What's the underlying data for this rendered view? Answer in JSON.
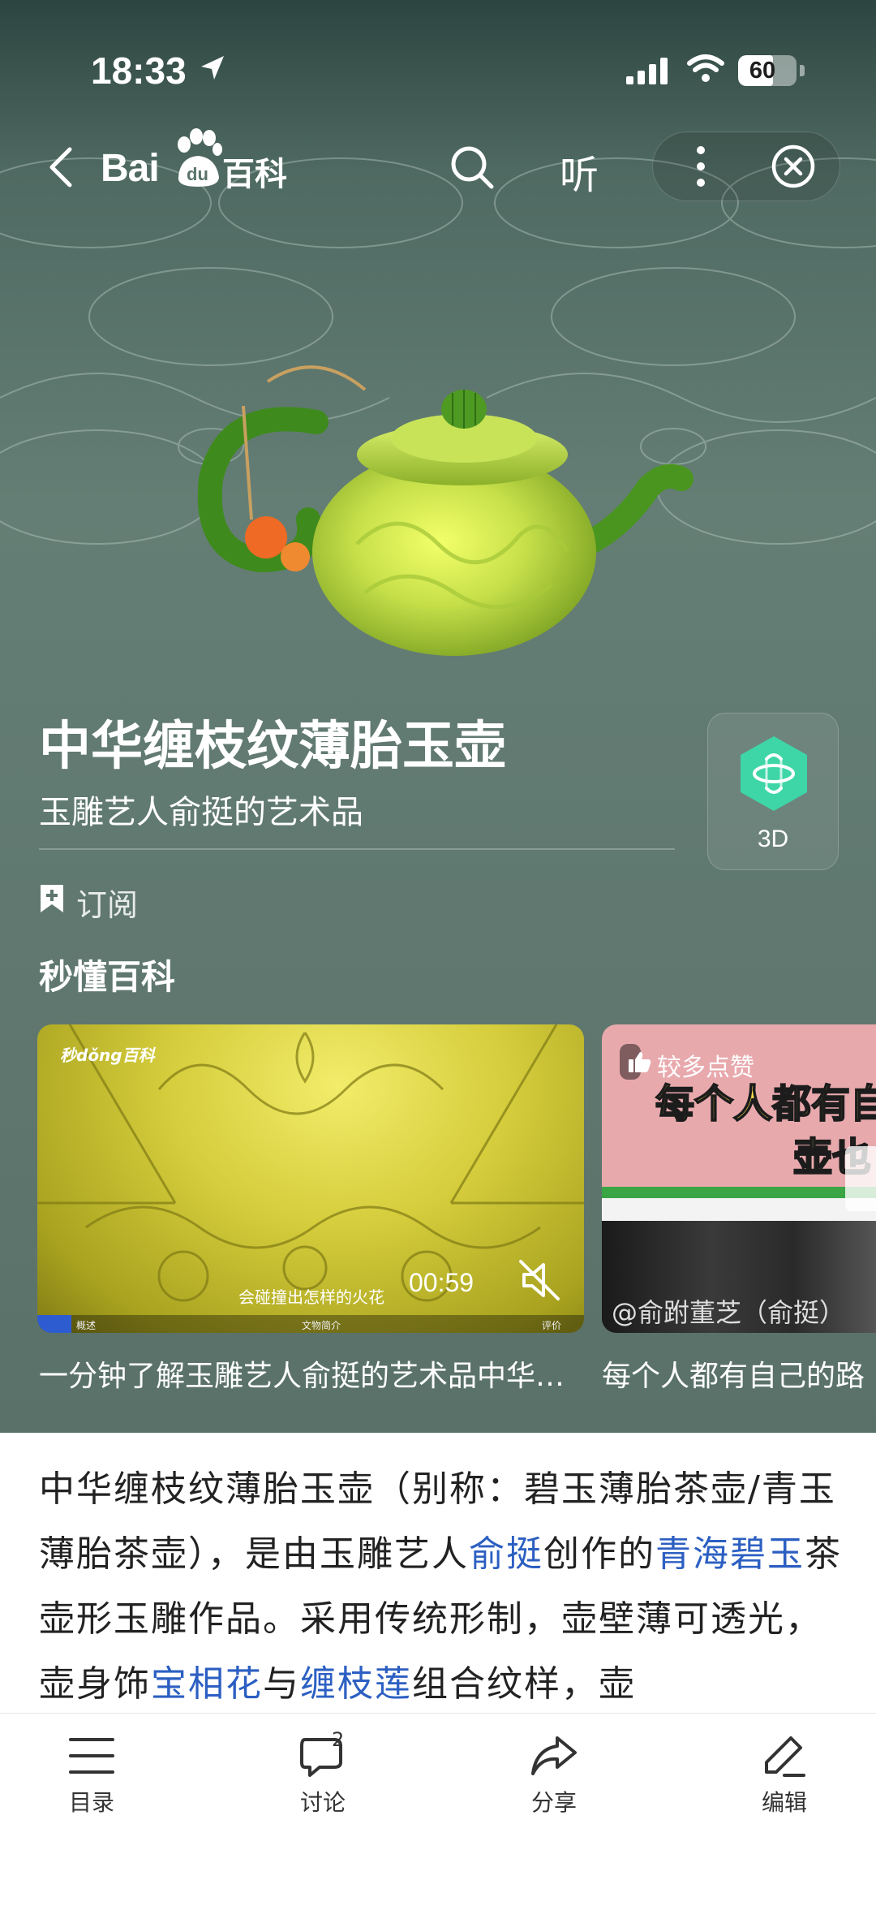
{
  "status_bar": {
    "time": "18:33",
    "battery": "60",
    "battery_level": 0.6,
    "icons": [
      "location-arrow-icon",
      "cellular-signal-icon",
      "wifi-icon",
      "battery-icon"
    ]
  },
  "nav": {
    "logo_latin": "Bai",
    "logo_du": "du",
    "logo_baike": "百科",
    "listen_label": "听",
    "icons": [
      "back-chevron-icon",
      "search-icon",
      "more-vertical-icon",
      "close-circle-icon"
    ]
  },
  "hero": {
    "title": "中华缠枝纹薄胎玉壶",
    "subtitle": "玉雕艺人俞挺的艺术品",
    "three_d_label": "3D",
    "subscribe_label": "订阅",
    "section_title": "秒懂百科"
  },
  "videos": [
    {
      "brand": "秒dǒng百科",
      "caption": "会碰撞出怎样的火花",
      "duration": "00:59",
      "segments": [
        "概述",
        "文物简介",
        "评价"
      ],
      "title": "一分钟了解玉雕艺人俞挺的艺术品中华缠枝纹薄胎玉壶"
    },
    {
      "badge": "较多点赞",
      "overlay_line1": "每个人都有自",
      "overlay_line2": "壶也",
      "handle": "@俞跗董芝（俞挺）",
      "title": "每个人都有自己的路"
    }
  ],
  "article": {
    "p1": "中华缠枝纹薄胎玉壶（别称：碧玉薄胎茶壶/青玉薄胎茶壶），是由玉雕艺人",
    "link1": "俞挺",
    "p2": "创作的",
    "link2": "青海碧玉",
    "p3": "茶壶形玉雕作品。采用传统形制，壶壁薄可透光，壶身饰",
    "link3": "宝相花",
    "p4": "与",
    "link4": "缠枝莲",
    "p5": "组合纹样，壶"
  },
  "toolbar": {
    "items": [
      {
        "label": "目录",
        "icon": "list-icon"
      },
      {
        "label": "讨论",
        "icon": "comment-icon",
        "count": "2"
      },
      {
        "label": "分享",
        "icon": "share-icon"
      },
      {
        "label": "编辑",
        "icon": "edit-pencil-icon"
      }
    ]
  },
  "colors": {
    "hero_bg": "#647e75",
    "link": "#2c5fc2",
    "three_d_icon": "#3ed6a6",
    "teapot_green": "#b8d84a"
  }
}
